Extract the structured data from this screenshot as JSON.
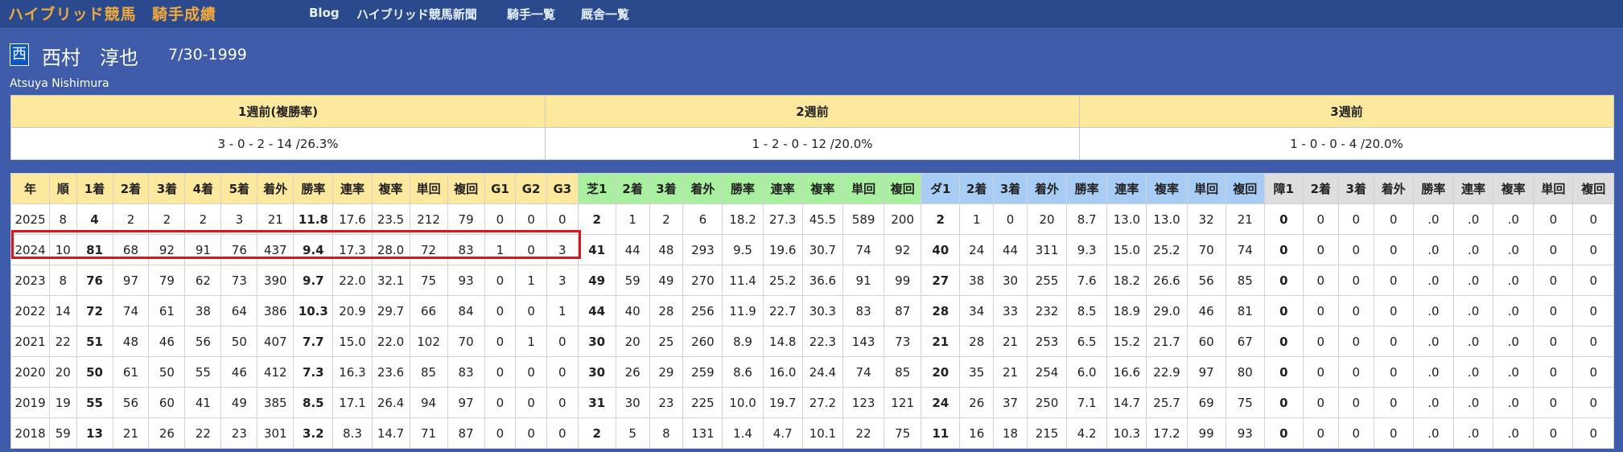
{
  "nav": {
    "brand": "ハイブリッド競馬",
    "section": "騎手成績",
    "links": [
      "Blog",
      "ハイブリッド競馬新聞",
      "騎手一覧",
      "厩舎一覧"
    ]
  },
  "jockey": {
    "icon_char": "西",
    "name": "西村　淳也",
    "birth_date": "7/30-1999",
    "roman_name": "Atsuya Nishimura"
  },
  "recent": {
    "headers": [
      "1週前(複勝率)",
      "2週前",
      "3週前"
    ],
    "values": [
      "3 - 0 - 2 - 14 /26.3%",
      "1 - 2 - 0 - 12 /20.0%",
      "1 - 0 - 0 - 4 /20.0%"
    ]
  },
  "stats": {
    "headers": [
      "年",
      "順",
      "1着",
      "2着",
      "3着",
      "4着",
      "5着",
      "着外",
      "勝率",
      "連率",
      "複率",
      "単回",
      "複回",
      "G1",
      "G2",
      "G3",
      "芝1",
      "2着",
      "3着",
      "着外",
      "勝率",
      "連率",
      "複率",
      "単回",
      "複回",
      "ダ1",
      "2着",
      "3着",
      "着外",
      "勝率",
      "連率",
      "複率",
      "単回",
      "複回",
      "障1",
      "2着",
      "3着",
      "着外",
      "勝率",
      "連率",
      "複率",
      "単回",
      "複回"
    ],
    "header_groups": {
      "overall": "#fde99e",
      "turf": "#a9efa0",
      "dirt": "#a8cdf4",
      "jump": "#dedede"
    },
    "rows": [
      [
        "2025",
        "8",
        "4",
        "2",
        "2",
        "2",
        "3",
        "21",
        "11.8",
        "17.6",
        "23.5",
        "212",
        "79",
        "0",
        "0",
        "0",
        "2",
        "1",
        "2",
        "6",
        "18.2",
        "27.3",
        "45.5",
        "589",
        "200",
        "2",
        "1",
        "0",
        "20",
        "8.7",
        "13.0",
        "13.0",
        "32",
        "21",
        "0",
        "0",
        "0",
        "0",
        ".0",
        ".0",
        ".0",
        "0",
        "0"
      ],
      [
        "2024",
        "10",
        "81",
        "68",
        "92",
        "91",
        "76",
        "437",
        "9.4",
        "17.3",
        "28.0",
        "72",
        "83",
        "1",
        "0",
        "3",
        "41",
        "44",
        "48",
        "293",
        "9.5",
        "19.6",
        "30.7",
        "74",
        "92",
        "40",
        "24",
        "44",
        "311",
        "9.3",
        "15.0",
        "25.2",
        "70",
        "74",
        "0",
        "0",
        "0",
        "0",
        ".0",
        ".0",
        ".0",
        "0",
        "0"
      ],
      [
        "2023",
        "8",
        "76",
        "97",
        "79",
        "62",
        "73",
        "390",
        "9.7",
        "22.0",
        "32.1",
        "75",
        "93",
        "0",
        "1",
        "3",
        "49",
        "59",
        "49",
        "270",
        "11.4",
        "25.2",
        "36.6",
        "91",
        "99",
        "27",
        "38",
        "30",
        "255",
        "7.6",
        "18.2",
        "26.6",
        "56",
        "85",
        "0",
        "0",
        "0",
        "0",
        ".0",
        ".0",
        ".0",
        "0",
        "0"
      ],
      [
        "2022",
        "14",
        "72",
        "74",
        "61",
        "38",
        "64",
        "386",
        "10.3",
        "20.9",
        "29.7",
        "66",
        "84",
        "0",
        "0",
        "1",
        "44",
        "40",
        "28",
        "256",
        "11.9",
        "22.7",
        "30.3",
        "83",
        "87",
        "28",
        "34",
        "33",
        "232",
        "8.5",
        "18.9",
        "29.0",
        "46",
        "81",
        "0",
        "0",
        "0",
        "0",
        ".0",
        ".0",
        ".0",
        "0",
        "0"
      ],
      [
        "2021",
        "22",
        "51",
        "48",
        "46",
        "56",
        "50",
        "407",
        "7.7",
        "15.0",
        "22.0",
        "102",
        "70",
        "0",
        "1",
        "0",
        "30",
        "20",
        "25",
        "260",
        "8.9",
        "14.8",
        "22.3",
        "143",
        "73",
        "21",
        "28",
        "21",
        "253",
        "6.5",
        "15.2",
        "21.7",
        "60",
        "67",
        "0",
        "0",
        "0",
        "0",
        ".0",
        ".0",
        ".0",
        "0",
        "0"
      ],
      [
        "2020",
        "20",
        "50",
        "61",
        "50",
        "55",
        "46",
        "412",
        "7.3",
        "16.3",
        "23.6",
        "85",
        "83",
        "0",
        "0",
        "0",
        "30",
        "26",
        "29",
        "259",
        "8.6",
        "16.0",
        "24.4",
        "74",
        "85",
        "20",
        "35",
        "21",
        "254",
        "6.0",
        "16.6",
        "22.9",
        "97",
        "80",
        "0",
        "0",
        "0",
        "0",
        ".0",
        ".0",
        ".0",
        "0",
        "0"
      ],
      [
        "2019",
        "19",
        "55",
        "56",
        "60",
        "41",
        "49",
        "385",
        "8.5",
        "17.1",
        "26.4",
        "94",
        "97",
        "0",
        "0",
        "0",
        "31",
        "30",
        "23",
        "225",
        "10.0",
        "19.7",
        "27.2",
        "123",
        "121",
        "24",
        "26",
        "37",
        "250",
        "7.1",
        "14.7",
        "25.7",
        "69",
        "75",
        "0",
        "0",
        "0",
        "0",
        ".0",
        ".0",
        ".0",
        "0",
        "0"
      ],
      [
        "2018",
        "59",
        "13",
        "21",
        "26",
        "22",
        "23",
        "301",
        "3.2",
        "8.3",
        "14.7",
        "71",
        "87",
        "0",
        "0",
        "0",
        "2",
        "5",
        "8",
        "131",
        "1.4",
        "4.7",
        "10.1",
        "22",
        "75",
        "11",
        "16",
        "18",
        "215",
        "4.2",
        "10.3",
        "17.2",
        "99",
        "93",
        "0",
        "0",
        "0",
        "0",
        ".0",
        ".0",
        ".0",
        "0",
        "0"
      ]
    ],
    "highlighted_row": "2024",
    "highlight_color": "#e0141e"
  }
}
